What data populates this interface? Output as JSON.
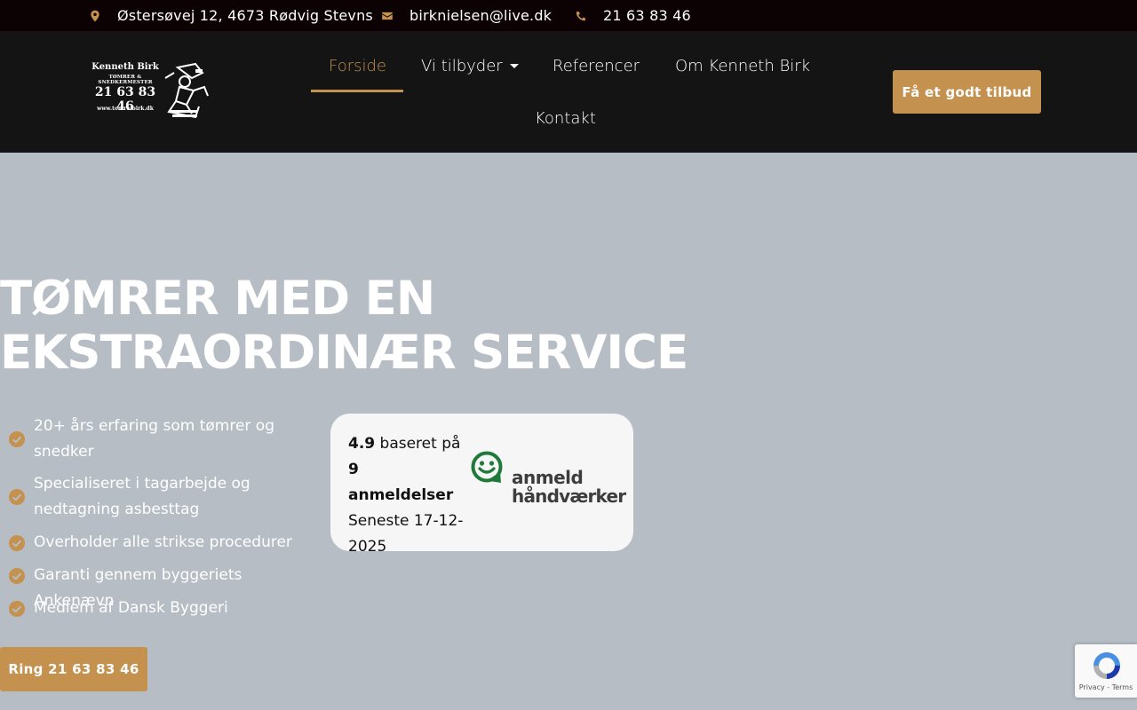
{
  "topbar": {
    "address": "Østersøvej 12, 4673 Rødvig Stevns",
    "email": "birknielsen@live.dk",
    "phone": "21 63 83 46"
  },
  "logo": {
    "name": "Kenneth Birk",
    "subtitle": "TØMRER & SNEDKERMESTER",
    "phone": "21 63 83 46",
    "url": "www.tomre-birk.dk"
  },
  "nav": {
    "items": [
      {
        "label": "Forside",
        "active": true
      },
      {
        "label": "Vi tilbyder",
        "has_dropdown": true
      },
      {
        "label": "Referencer"
      },
      {
        "label": "Om Kenneth Birk"
      },
      {
        "label": "Kontakt"
      }
    ],
    "cta": "Få et godt tilbud"
  },
  "hero": {
    "title_line1": "TØMRER MED EN",
    "title_line2": "EKSTRAORDINÆR SERVICE",
    "features": [
      "20+ års erfaring som tømrer og snedker",
      "Specialiseret i tagarbejde og nedtagning asbesttag",
      "Overholder alle strikse procedurer",
      "Garanti gennem byggeriets Ankenævn",
      "Medlem af Dansk Byggeri"
    ],
    "call_button": "Ring 21 63 83 46"
  },
  "review": {
    "rating": "4.9",
    "based_on": "baseret på",
    "count": "9 anmeldelser",
    "latest": "Seneste 17-12-2025",
    "brand_line1": "anmeld",
    "brand_line2": "håndværker"
  },
  "recaptcha": {
    "links": "Privacy - Terms"
  },
  "colors": {
    "accent": "#c4914f",
    "topbar_bg": "#0c0203",
    "header_bg": "#141414",
    "hero_bg": "#b6bdc5",
    "review_green": "#1f7a3a"
  }
}
